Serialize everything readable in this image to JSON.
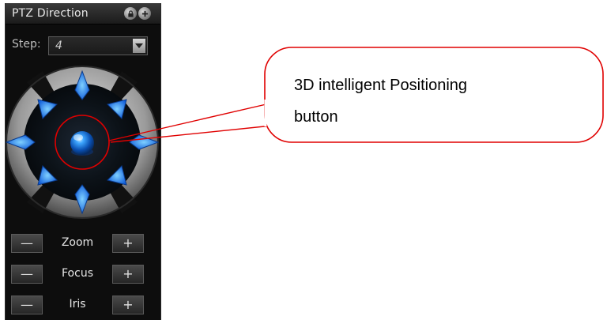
{
  "panel": {
    "title": "PTZ Direction",
    "title_icons": [
      "lock-icon",
      "plus-icon"
    ],
    "step": {
      "label": "Step:",
      "value": "4"
    },
    "directions": [
      "up",
      "up-right",
      "right",
      "down-right",
      "down",
      "down-left",
      "left",
      "up-left"
    ],
    "center_button": "3D positioning button",
    "controls": [
      {
        "label": "Zoom",
        "minus": "—",
        "plus": "+"
      },
      {
        "label": "Focus",
        "minus": "—",
        "plus": "+"
      },
      {
        "label": "Iris",
        "minus": "—",
        "plus": "+"
      }
    ]
  },
  "callout": {
    "line1": "3D intelligent Positioning",
    "line2": "button",
    "color": "#e00000"
  },
  "colors": {
    "panel_bg": "#0d0d0d",
    "arrow_blue": "#1e7bff",
    "ring_grey": "#9a9a9a"
  }
}
